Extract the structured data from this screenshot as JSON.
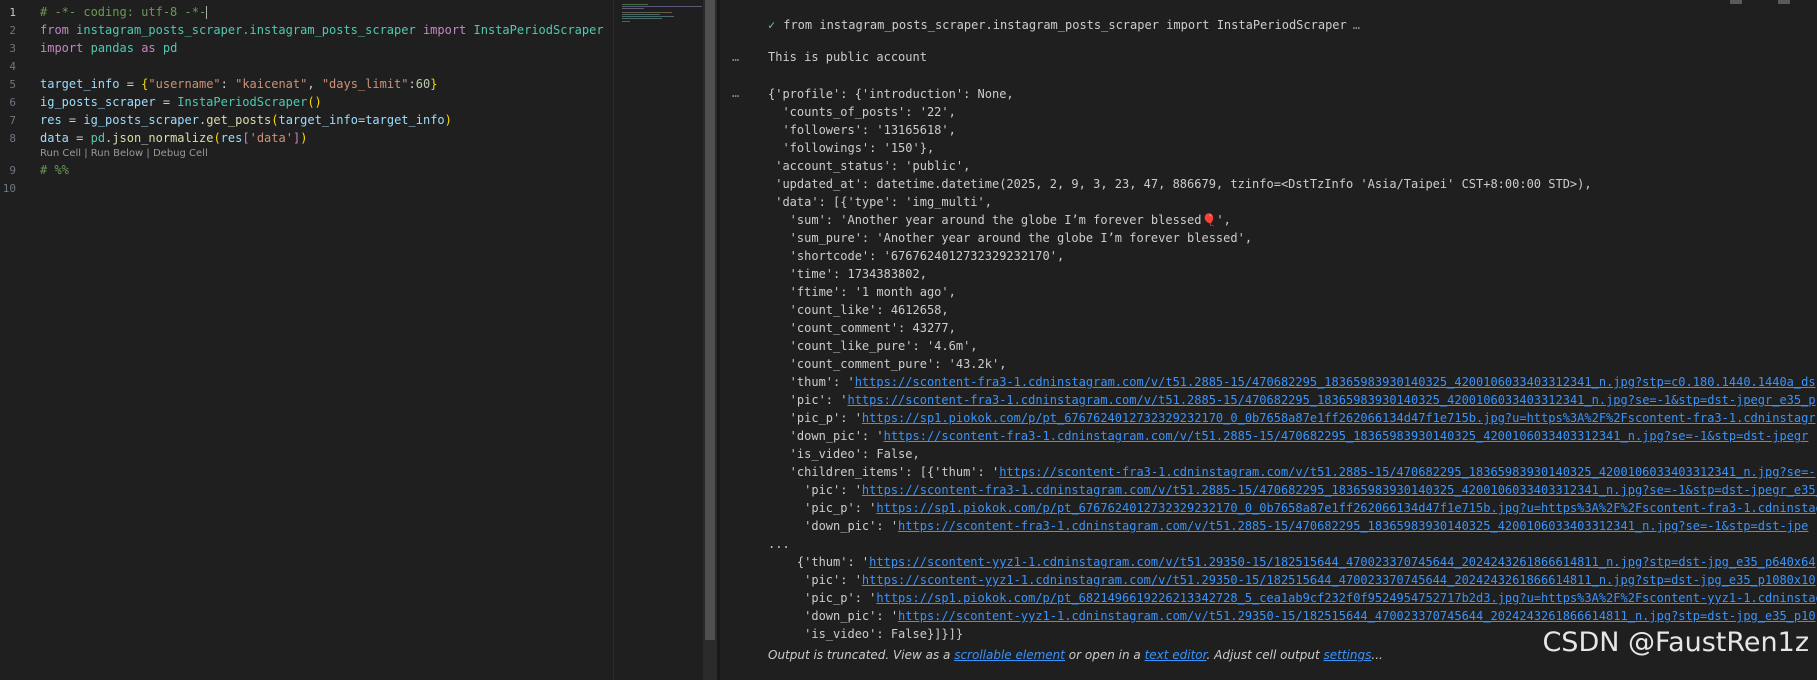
{
  "editor": {
    "line_numbers": [
      "1",
      "2",
      "3",
      "4",
      "5",
      "6",
      "7",
      "8",
      "9",
      "10"
    ],
    "code": {
      "l1": "# -*- coding: utf-8 -*-",
      "l2_from": "from",
      "l2_module": "instagram_posts_scraper.instagram_posts_scraper",
      "l2_import": "import",
      "l2_class": "InstaPeriodScraper",
      "l3_import": "import",
      "l3_module": "pandas",
      "l3_as": "as",
      "l3_alias": "pd",
      "l5_var": "target_info",
      "l5_eq": " = ",
      "l5_open": "{",
      "l5_key1": "\"username\"",
      "l5_colon1": ": ",
      "l5_val1": "\"kaicenat\"",
      "l5_comma": ", ",
      "l5_key2": "\"days_limit\"",
      "l5_colon2": ":",
      "l5_val2": "60",
      "l5_close": "}",
      "l6_var": "ig_posts_scraper",
      "l6_eq": " = ",
      "l6_class": "InstaPeriodScraper",
      "l6_paren": "()",
      "l7_var": "res",
      "l7_eq": " = ",
      "l7_obj": "ig_posts_scraper",
      "l7_dot": ".",
      "l7_fn": "get_posts",
      "l7_open": "(",
      "l7_arg": "target_info",
      "l7_eq2": "=",
      "l7_val": "target_info",
      "l7_close": ")",
      "l8_var": "data",
      "l8_eq": " = ",
      "l8_mod": "pd",
      "l8_dot": ".",
      "l8_fn": "json_normalize",
      "l8_open": "(",
      "l8_arg": "res",
      "l8_bopen": "[",
      "l8_key": "'data'",
      "l8_bclose": "]",
      "l8_close": ")",
      "l9": "# %%"
    },
    "codelens": {
      "run_cell": "Run Cell",
      "sep1": " | ",
      "run_below": "Run Below",
      "sep2": " | ",
      "debug_cell": "Debug Cell"
    }
  },
  "output": {
    "cell_header": "from instagram_posts_scraper.instagram_posts_scraper import InstaPeriodScraper",
    "ellipsis_glyph": "…",
    "dots": "…",
    "dots_glyph": "...",
    "line_public": "This is public account",
    "lines": [
      "{'profile': {'introduction': None,",
      "  'counts_of_posts': '22',",
      "  'followers': '13165618',",
      "  'followings': '150'},",
      " 'account_status': 'public',",
      " 'updated_at': datetime.datetime(2025, 2, 9, 3, 23, 47, 886679, tzinfo=<DstTzInfo 'Asia/Taipei' CST+8:00:00 STD>),",
      " 'data': [{'type': 'img_multi',",
      "   'sum': 'Another year around the globe I’m forever blessed🎈',",
      "   'sum_pure': 'Another year around the globe I’m forever blessed',",
      "   'shortcode': '6767624012732329232170',",
      "   'time': 1734383802,",
      "   'ftime': '1 month ago',",
      "   'count_like': 4612658,",
      "   'count_comment': 43277,",
      "   'count_like_pure': '4.6m',",
      "   'count_comment_pure': '43.2k',"
    ],
    "link_lines": [
      {
        "prefix": "   'thum': '",
        "url": "https://scontent-fra3-1.cdninstagram.com/v/t51.2885-15/470682295_18365983930140325_4200106033403312341_n.jpg?stp=c0.180.1440.1440a_ds"
      },
      {
        "prefix": "   'pic': '",
        "url": "https://scontent-fra3-1.cdninstagram.com/v/t51.2885-15/470682295_18365983930140325_4200106033403312341_n.jpg?se=-1&stp=dst-jpegr_e35_p"
      },
      {
        "prefix": "   'pic_p': '",
        "url": "https://sp1.piokok.com/p/pt_6767624012732329232170_0_0b7658a87e1ff262066134d47f1e715b.jpg?u=https%3A%2F%2Fscontent-fra3-1.cdninstagr"
      },
      {
        "prefix": "   'down_pic': '",
        "url": "https://scontent-fra3-1.cdninstagram.com/v/t51.2885-15/470682295_18365983930140325_4200106033403312341_n.jpg?se=-1&stp=dst-jpegr"
      }
    ],
    "is_video_line": "   'is_video': False,",
    "children_prefix": "   'children_items': [{'thum': '",
    "children_url": "https://scontent-fra3-1.cdninstagram.com/v/t51.2885-15/470682295_18365983930140325_4200106033403312341_n.jpg?se=-",
    "children_lines": [
      {
        "prefix": "     'pic': '",
        "url": "https://scontent-fra3-1.cdninstagram.com/v/t51.2885-15/470682295_18365983930140325_4200106033403312341_n.jpg?se=-1&stp=dst-jpegr_e35_p"
      },
      {
        "prefix": "     'pic_p': '",
        "url": "https://sp1.piokok.com/p/pt_6767624012732329232170_0_0b7658a87e1ff262066134d47f1e715b.jpg?u=https%3A%2F%2Fscontent-fra3-1.cdninstagram"
      },
      {
        "prefix": "     'down_pic': '",
        "url": "https://scontent-fra3-1.cdninstagram.com/v/t51.2885-15/470682295_18365983930140325_4200106033403312341_n.jpg?se=-1&stp=dst-jpe"
      }
    ],
    "truncated_dots": "...",
    "tail_lines": [
      {
        "prefix": "    {'thum': '",
        "url": "https://scontent-yyz1-1.cdninstagram.com/v/t51.29350-15/182515644_470023370745644_2024243261866614811_n.jpg?stp=dst-jpg_e35_p640x64"
      },
      {
        "prefix": "     'pic': '",
        "url": "https://scontent-yyz1-1.cdninstagram.com/v/t51.29350-15/182515644_470023370745644_2024243261866614811_n.jpg?stp=dst-jpg_e35_p1080x10"
      },
      {
        "prefix": "     'pic_p': '",
        "url": "https://sp1.piokok.com/p/pt_6821496619226213342728_5_cea1ab9cf232f0f9524954752717b2d3.jpg?u=https%3A%2F%2Fscontent-yyz1-1.cdninstagr"
      },
      {
        "prefix": "     'down_pic': '",
        "url": "https://scontent-yyz1-1.cdninstagram.com/v/t51.29350-15/182515644_470023370745644_2024243261866614811_n.jpg?stp=dst-jpg_e35_p10"
      }
    ],
    "last_line": "     'is_video': False}]}]}",
    "truncation": {
      "text1": "Output is truncated. View as a ",
      "link1": "scrollable element",
      "text2": " or open in a ",
      "link2": "text editor",
      "text3": ". Adjust cell output ",
      "link3": "settings",
      "text4": "..."
    }
  },
  "watermark": "CSDN @FaustRen1z",
  "icons": {
    "check": "check-icon",
    "ellipsis": "ellipsis-icon"
  },
  "colors": {
    "background": "#1f1f1f",
    "link": "#3794ff",
    "comment": "#6a9955",
    "keyword": "#c586c0",
    "class": "#4ec9b0",
    "string": "#ce9178"
  }
}
